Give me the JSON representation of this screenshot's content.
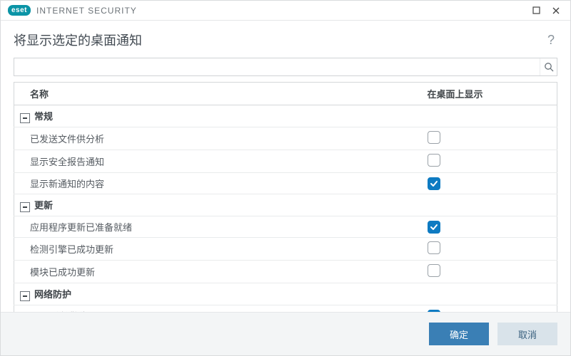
{
  "brand": {
    "badge": "eset",
    "name": "INTERNET SECURITY"
  },
  "header": {
    "title": "将显示选定的桌面通知"
  },
  "search": {
    "value": "",
    "placeholder": ""
  },
  "columns": {
    "name": "名称",
    "show": "在桌面上显示"
  },
  "categories": [
    {
      "label": "常规",
      "items": [
        {
          "label": "已发送文件供分析",
          "checked": false
        },
        {
          "label": "显示安全报告通知",
          "checked": false
        },
        {
          "label": "显示新通知的内容",
          "checked": true
        }
      ]
    },
    {
      "label": "更新",
      "items": [
        {
          "label": "应用程序更新已准备就绪",
          "checked": true
        },
        {
          "label": "检测引擎已成功更新",
          "checked": false
        },
        {
          "label": "模块已成功更新",
          "checked": false
        }
      ]
    },
    {
      "label": "网络防护",
      "items": [
        {
          "label": "WiFi 防护警告",
          "checked": true
        }
      ]
    }
  ],
  "footer": {
    "ok": "确定",
    "cancel": "取消"
  }
}
